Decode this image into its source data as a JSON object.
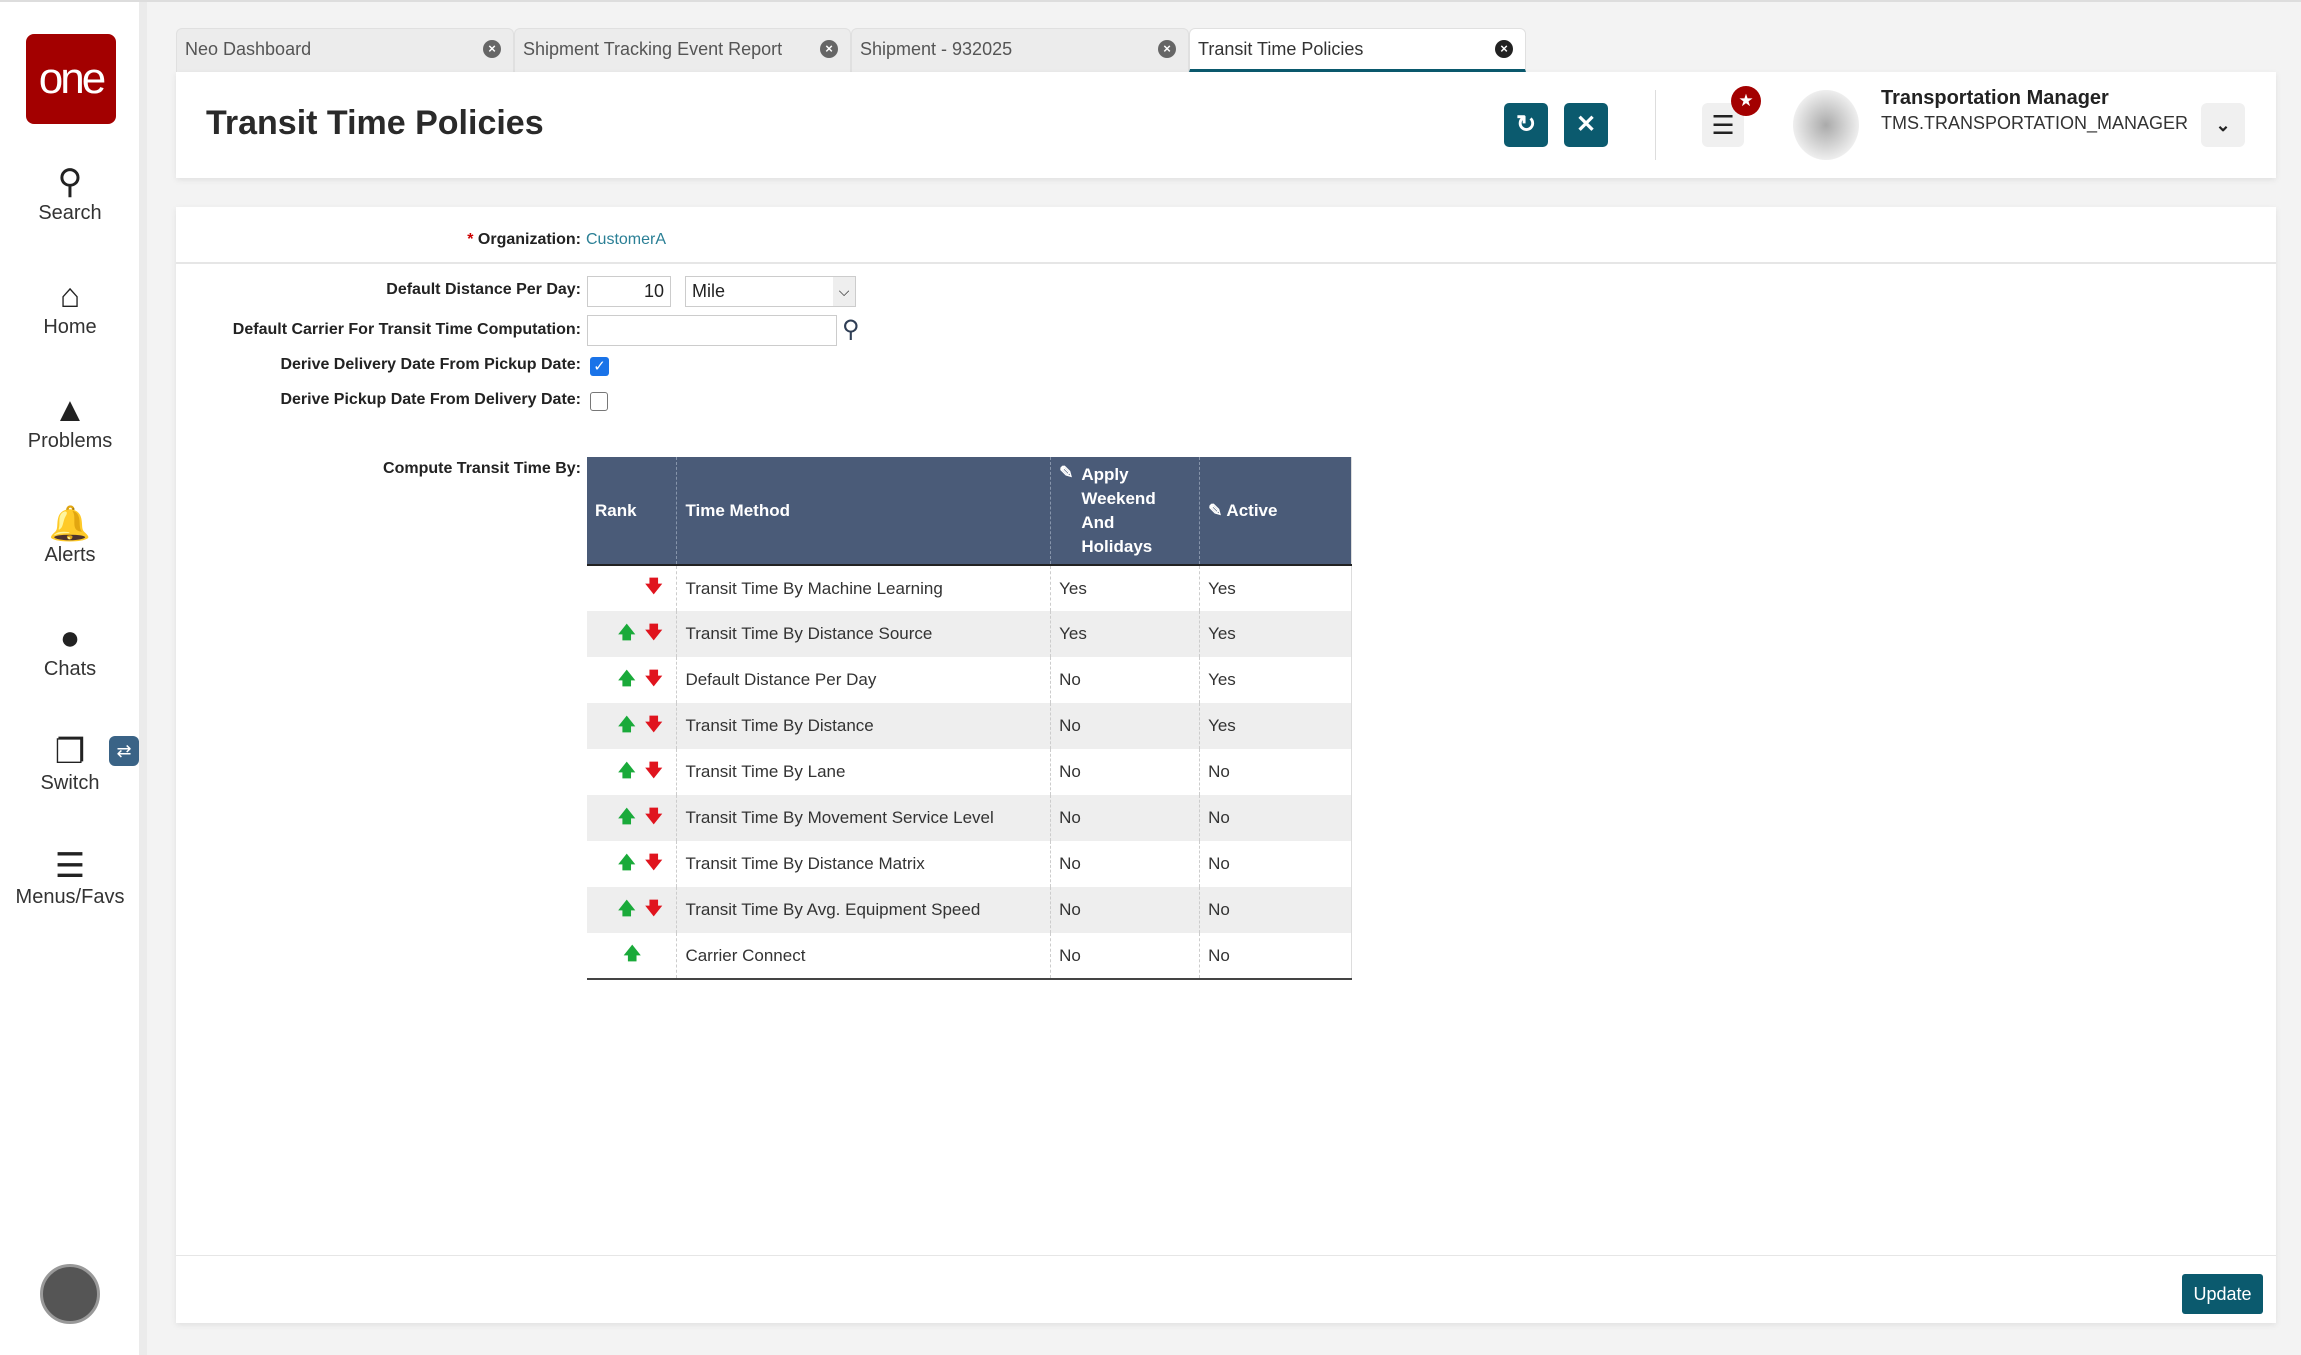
{
  "sidebar": {
    "logo": "one",
    "items": [
      {
        "label": "Search",
        "icon": "search-icon"
      },
      {
        "label": "Home",
        "icon": "home-icon"
      },
      {
        "label": "Problems",
        "icon": "warning-icon"
      },
      {
        "label": "Alerts",
        "icon": "bell-icon"
      },
      {
        "label": "Chats",
        "icon": "chat-icon"
      },
      {
        "label": "Switch",
        "icon": "switch-icon"
      },
      {
        "label": "Menus/Favs",
        "icon": "menu-icon"
      }
    ]
  },
  "tabs": [
    {
      "label": "Neo Dashboard"
    },
    {
      "label": "Shipment Tracking Event Report"
    },
    {
      "label": "Shipment - 932025"
    },
    {
      "label": "Transit Time Policies",
      "active": true
    }
  ],
  "header": {
    "title": "Transit Time Policies",
    "user_name": "Transportation Manager",
    "user_role": "TMS.TRANSPORTATION_MANAGER"
  },
  "colors": {
    "accent": "#0b5a6e",
    "brand": "#a30000",
    "table_header": "#4a5b78"
  },
  "form": {
    "org_label": "Organization:",
    "org_required": "*",
    "org_value": "CustomerA",
    "distance_label": "Default Distance Per Day:",
    "distance_value": "10",
    "distance_unit": "Mile",
    "carrier_label": "Default Carrier For Transit Time Computation:",
    "carrier_value": "",
    "derive_delivery_label": "Derive Delivery Date From Pickup Date:",
    "derive_delivery_checked": true,
    "derive_pickup_label": "Derive Pickup Date From Delivery Date:",
    "derive_pickup_checked": false,
    "compute_label": "Compute Transit Time By:"
  },
  "table": {
    "headers": {
      "rank": "Rank",
      "method": "Time Method",
      "apply": "Apply Weekend And Holidays",
      "active": "Active"
    },
    "rows": [
      {
        "method": "Transit Time By Machine Learning",
        "apply": "Yes",
        "active": "Yes",
        "up": false,
        "down": true
      },
      {
        "method": "Transit Time By Distance Source",
        "apply": "Yes",
        "active": "Yes",
        "up": true,
        "down": true
      },
      {
        "method": "Default Distance Per Day",
        "apply": "No",
        "active": "Yes",
        "up": true,
        "down": true
      },
      {
        "method": "Transit Time By Distance",
        "apply": "No",
        "active": "Yes",
        "up": true,
        "down": true
      },
      {
        "method": "Transit Time By Lane",
        "apply": "No",
        "active": "No",
        "up": true,
        "down": true
      },
      {
        "method": "Transit Time By Movement Service Level",
        "apply": "No",
        "active": "No",
        "up": true,
        "down": true
      },
      {
        "method": "Transit Time By Distance Matrix",
        "apply": "No",
        "active": "No",
        "up": true,
        "down": true
      },
      {
        "method": "Transit Time By Avg. Equipment Speed",
        "apply": "No",
        "active": "No",
        "up": true,
        "down": true
      },
      {
        "method": "Carrier Connect",
        "apply": "No",
        "active": "No",
        "up": true,
        "down": false
      }
    ]
  },
  "footer": {
    "update_label": "Update"
  }
}
